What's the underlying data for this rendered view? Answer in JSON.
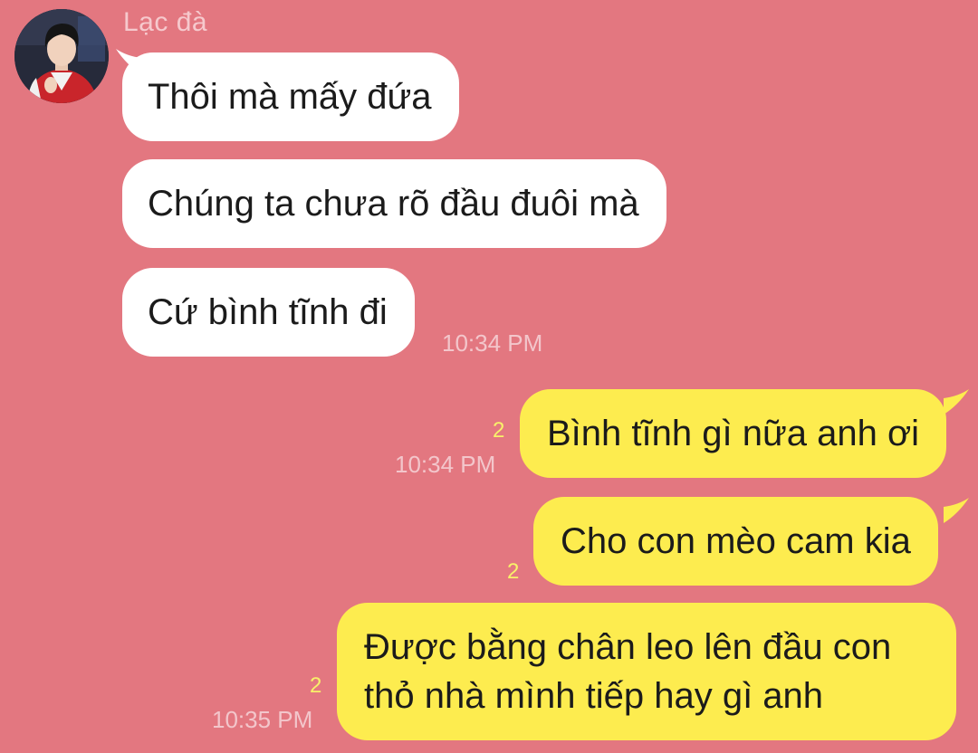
{
  "sender": {
    "name": "Lạc đà"
  },
  "messages_in": [
    {
      "text": "Thôi mà mấy đứa"
    },
    {
      "text": "Chúng ta chưa rõ đầu đuôi mà"
    },
    {
      "text": "Cứ bình tĩnh đi",
      "time": "10:34 PM"
    }
  ],
  "messages_out": [
    {
      "text": "Bình tĩnh gì nữa anh ơi",
      "unread": "2",
      "time": "10:34 PM"
    },
    {
      "text": "Cho con mèo cam kia",
      "unread": "2"
    },
    {
      "text": "Được bằng chân leo lên đầu con thỏ nhà mình tiếp hay gì anh",
      "unread": "2",
      "time": "10:35 PM"
    }
  ],
  "colors": {
    "background": "#e37780",
    "incoming_bubble": "#ffffff",
    "outgoing_bubble": "#fdec4f",
    "unread_count": "#f8f16a",
    "timestamp": "#f3c6cb"
  }
}
